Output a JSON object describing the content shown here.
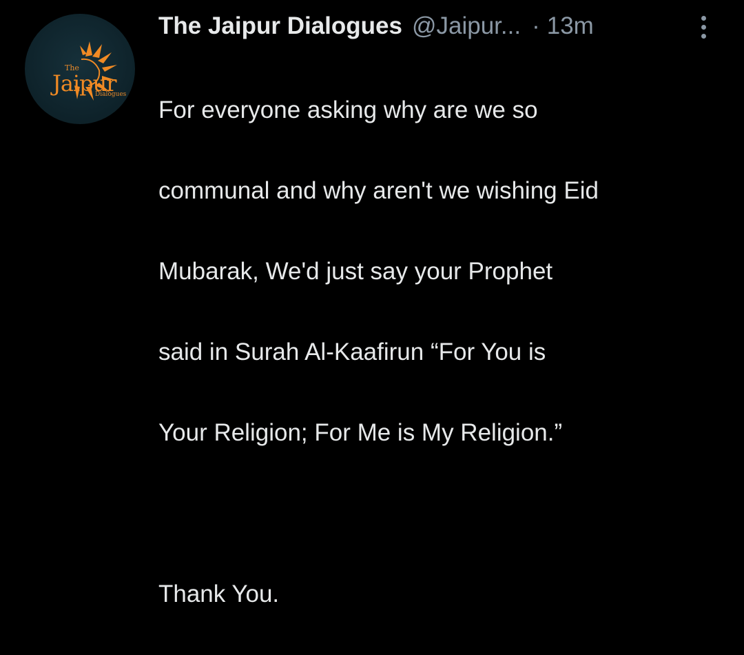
{
  "tweet": {
    "display_name": "The Jaipur Dialogues",
    "handle": "@Jaipur...",
    "separator": "·",
    "timestamp": "13m",
    "more_icon": "more-vertical-icon",
    "avatar": {
      "logo_small": "The",
      "logo_main": "Jaipur",
      "logo_sub": "Dialogues",
      "colors": {
        "background": "#0f242c",
        "accent": "#f08a24"
      }
    },
    "text_lines": [
      "For everyone asking why are we so",
      "communal and why aren't we wishing Eid",
      "Mubarak, We'd just say your Prophet",
      "said in Surah Al-Kaafirun “For You is",
      "Your Religion; For Me is My Religion.”",
      "",
      "Thank You."
    ]
  },
  "colors": {
    "background": "#000000",
    "primary_text": "#e7e9ea",
    "secondary_text": "#8b98a5"
  }
}
